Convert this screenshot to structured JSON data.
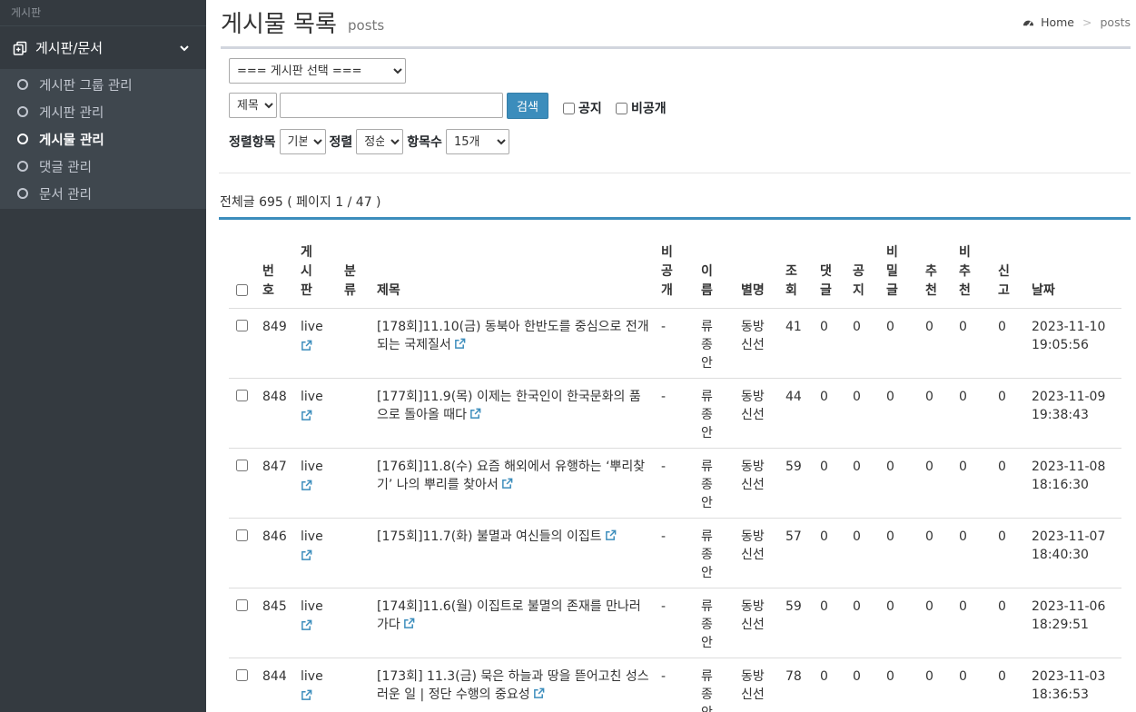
{
  "sidebar": {
    "header": "게시판",
    "group_label": "게시판/문서",
    "items": [
      {
        "label": "게시판 그룹 관리",
        "active": false
      },
      {
        "label": "게시판 관리",
        "active": false
      },
      {
        "label": "게시물 관리",
        "active": true
      },
      {
        "label": "댓글 관리",
        "active": false
      },
      {
        "label": "문서 관리",
        "active": false
      }
    ]
  },
  "header": {
    "title": "게시물 목록",
    "subtitle": "posts",
    "breadcrumb_home": "Home",
    "breadcrumb_sep": ">",
    "breadcrumb_current": "posts"
  },
  "filters": {
    "board_select": "=== 게시판 선택 ===",
    "field_select": "제목",
    "search_value": "",
    "search_button": "검색",
    "notice_label": "공지",
    "private_label": "비공개",
    "sort_field_label": "정렬항목",
    "sort_field_value": "기본",
    "sort_order_label": "정렬",
    "sort_order_value": "정순",
    "page_size_label": "항목수",
    "page_size_value": "15개"
  },
  "summary": "전체글 695 ( 페이지 1 / 47 )",
  "table": {
    "headers": {
      "no": "번호",
      "board": "게시판",
      "category": "분류",
      "title": "제목",
      "private": "비공개",
      "name": "이름",
      "nick": "별명",
      "views": "조회",
      "comments": "댓글",
      "notice": "공지",
      "secret": "비밀글",
      "recommend": "추천",
      "unrecommend": "비추천",
      "report": "신고",
      "date": "날짜"
    },
    "rows": [
      {
        "no": "849",
        "board": "live",
        "title": "[178회]11.10(금) 동북아 한반도를 중심으로 전개되는 국제질서",
        "private": "-",
        "name": "류종안",
        "nick": "동방신선",
        "views": "41",
        "comments": "0",
        "notice": "0",
        "secret": "0",
        "recommend": "0",
        "unrecommend": "0",
        "report": "0",
        "date": "2023-11-10",
        "time": "19:05:56"
      },
      {
        "no": "848",
        "board": "live",
        "title": "[177회]11.9(목) 이제는 한국인이 한국문화의 품으로 돌아올 때다",
        "private": "-",
        "name": "류종안",
        "nick": "동방신선",
        "views": "44",
        "comments": "0",
        "notice": "0",
        "secret": "0",
        "recommend": "0",
        "unrecommend": "0",
        "report": "0",
        "date": "2023-11-09",
        "time": "19:38:43"
      },
      {
        "no": "847",
        "board": "live",
        "title": "[176회]11.8(수) 요즘 해외에서 유행하는 ‘뿌리찾기’ 나의 뿌리를 찾아서",
        "private": "-",
        "name": "류종안",
        "nick": "동방신선",
        "views": "59",
        "comments": "0",
        "notice": "0",
        "secret": "0",
        "recommend": "0",
        "unrecommend": "0",
        "report": "0",
        "date": "2023-11-08",
        "time": "18:16:30"
      },
      {
        "no": "846",
        "board": "live",
        "title": "[175회]11.7(화) 불멸과 여신들의 이집트",
        "private": "-",
        "name": "류종안",
        "nick": "동방신선",
        "views": "57",
        "comments": "0",
        "notice": "0",
        "secret": "0",
        "recommend": "0",
        "unrecommend": "0",
        "report": "0",
        "date": "2023-11-07",
        "time": "18:40:30"
      },
      {
        "no": "845",
        "board": "live",
        "title": "[174회]11.6(월) 이집트로 불멸의 존재를 만나러 가다",
        "private": "-",
        "name": "류종안",
        "nick": "동방신선",
        "views": "59",
        "comments": "0",
        "notice": "0",
        "secret": "0",
        "recommend": "0",
        "unrecommend": "0",
        "report": "0",
        "date": "2023-11-06",
        "time": "18:29:51"
      },
      {
        "no": "844",
        "board": "live",
        "title": "[173회] 11.3(금) 묵은 하늘과 땅을 뜯어고친 성스러운 일 | 정단 수행의 중요성",
        "private": "-",
        "name": "류종안",
        "nick": "동방신선",
        "views": "78",
        "comments": "0",
        "notice": "0",
        "secret": "0",
        "recommend": "0",
        "unrecommend": "0",
        "report": "0",
        "date": "2023-11-03",
        "time": "18:36:53"
      }
    ]
  },
  "colors": {
    "sidebar_bg": "#343a40",
    "accent": "#3c8dbc",
    "link_icon": "#3c8dbc"
  },
  "icons": {
    "sidebar_group": "clipboard-copy-icon",
    "breadcrumb_home": "dashboard-gauge-icon",
    "row_link": "external-link-icon"
  }
}
